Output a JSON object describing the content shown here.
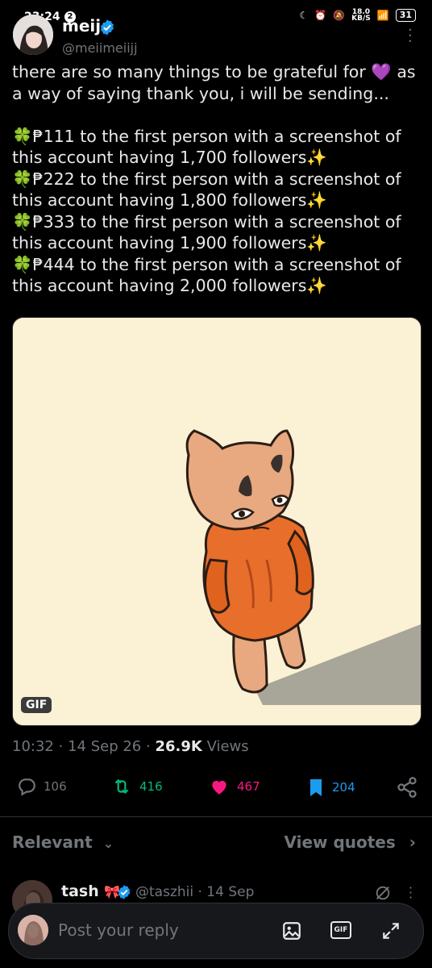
{
  "status_bar": {
    "time": "23:24",
    "notification_count": "2",
    "net_speed_top": "18.0",
    "net_speed_unit": "KB/S",
    "battery": "31"
  },
  "author": {
    "name": "meij",
    "handle": "@meiimeiijj"
  },
  "tweet": {
    "lines": [
      "there are so many things to be grateful for 💜 as a way of saying thank you, i will be sending...",
      "",
      "🍀₱111 to the first person with a screenshot of this account having 1,700 followers✨",
      "🍀₱222 to the first person with a screenshot of this account having 1,800 followers✨",
      "🍀₱333 to the first person with a screenshot of this account having 1,900 followers✨",
      "🍀₱444 to the first person with a screenshot of this account having 2,000 followers✨"
    ],
    "media_badge": "GIF",
    "time": "10:32",
    "date": "14 Sep 26",
    "views_count": "26.9K",
    "views_label": "Views",
    "separator": "·"
  },
  "actions": {
    "replies": "106",
    "reposts": "416",
    "likes": "467",
    "bookmarks": "204"
  },
  "colors": {
    "repost": "#00ba7c",
    "like": "#f91880",
    "bookmark": "#1d9bf0",
    "verified": "#1d9bf0"
  },
  "replies_header": {
    "sort": "Relevant",
    "view_quotes": "View quotes"
  },
  "reply_preview": {
    "name": "tash",
    "name_suffix": "🎀",
    "handle_date": "@taszhii · 14 Sep"
  },
  "composer": {
    "placeholder": "Post your reply"
  }
}
